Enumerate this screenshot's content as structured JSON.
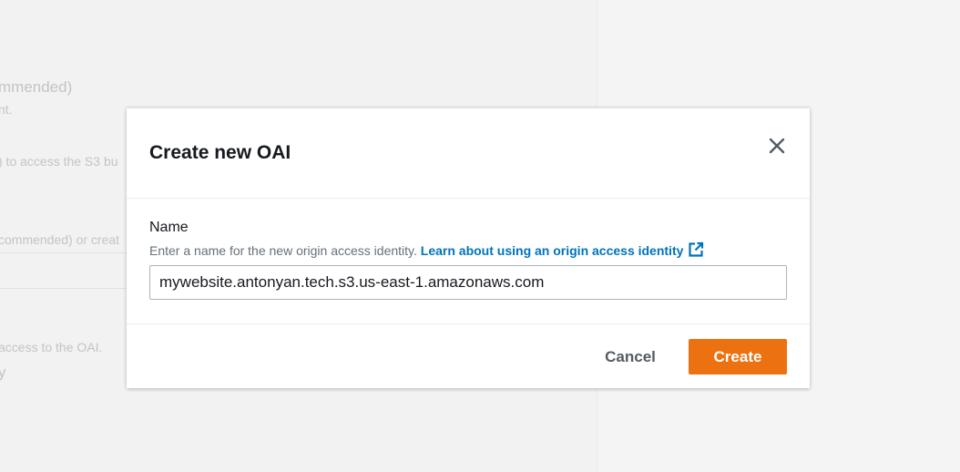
{
  "background": {
    "texts": [
      "mmended)",
      "nt.",
      ") to access the S3 bu",
      "commended) or creat",
      "access to the OAI.",
      "y"
    ]
  },
  "modal": {
    "title": "Create new OAI",
    "close_icon": "close-icon",
    "field": {
      "label": "Name",
      "description": "Enter a name for the new origin access identity.",
      "link_text": "Learn about using an origin access identity",
      "link_icon": "external-link-icon",
      "value": "mywebsite.antonyan.tech.s3.us-east-1.amazonaws.com"
    },
    "buttons": {
      "cancel": "Cancel",
      "create": "Create"
    }
  },
  "colors": {
    "primary_button": "#ec7211",
    "link": "#0073bb",
    "title": "#16191f",
    "muted": "#687078"
  }
}
